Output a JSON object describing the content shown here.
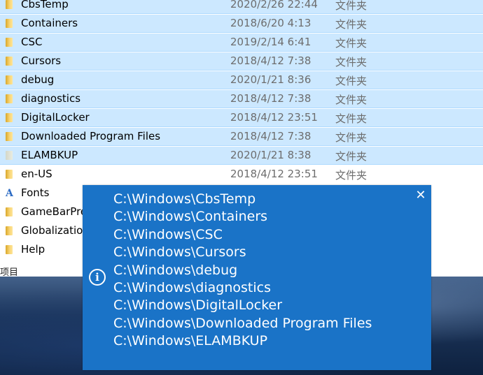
{
  "explorer": {
    "rows": [
      {
        "name": "CbsTemp",
        "date": "2020/2/26 22:44",
        "type": "文件夹",
        "selected": true,
        "icon": "folder-icon"
      },
      {
        "name": "Containers",
        "date": "2018/6/20 4:13",
        "type": "文件夹",
        "selected": true,
        "icon": "folder-icon"
      },
      {
        "name": "CSC",
        "date": "2019/2/14 6:41",
        "type": "文件夹",
        "selected": true,
        "icon": "folder-icon"
      },
      {
        "name": "Cursors",
        "date": "2018/4/12 7:38",
        "type": "文件夹",
        "selected": true,
        "icon": "folder-icon"
      },
      {
        "name": "debug",
        "date": "2020/1/21 8:36",
        "type": "文件夹",
        "selected": true,
        "icon": "folder-icon"
      },
      {
        "name": "diagnostics",
        "date": "2018/4/12 7:38",
        "type": "文件夹",
        "selected": true,
        "icon": "folder-icon"
      },
      {
        "name": "DigitalLocker",
        "date": "2018/4/12 23:51",
        "type": "文件夹",
        "selected": true,
        "icon": "folder-icon"
      },
      {
        "name": "Downloaded Program Files",
        "date": "2018/4/12 7:38",
        "type": "文件夹",
        "selected": true,
        "icon": "folder-icon"
      },
      {
        "name": "ELAMBKUP",
        "date": "2020/1/21 8:38",
        "type": "文件夹",
        "selected": true,
        "icon": "folder-pale-icon"
      },
      {
        "name": "en-US",
        "date": "2018/4/12 23:51",
        "type": "文件夹",
        "selected": false,
        "icon": "folder-icon"
      },
      {
        "name": "Fonts",
        "date": "",
        "type": "",
        "selected": false,
        "icon": "fonts-folder-icon"
      },
      {
        "name": "GameBarPre",
        "date": "",
        "type": "",
        "selected": false,
        "icon": "folder-icon"
      },
      {
        "name": "Globalization",
        "date": "",
        "type": "",
        "selected": false,
        "icon": "folder-icon"
      },
      {
        "name": "Help",
        "date": "",
        "type": "",
        "selected": false,
        "icon": "folder-icon"
      }
    ],
    "status_text": "项目"
  },
  "popup": {
    "close_glyph": "✕",
    "info_glyph": "i",
    "paths": [
      "C:\\Windows\\CbsTemp",
      "C:\\Windows\\Containers",
      "C:\\Windows\\CSC",
      "C:\\Windows\\Cursors",
      "C:\\Windows\\debug",
      "C:\\Windows\\diagnostics",
      "C:\\Windows\\DigitalLocker",
      "C:\\Windows\\Downloaded Program Files",
      "C:\\Windows\\ELAMBKUP"
    ],
    "background": "#1a73c7"
  },
  "colors": {
    "selection": "#cce8ff",
    "secondary_text": "#6d6d6d"
  }
}
